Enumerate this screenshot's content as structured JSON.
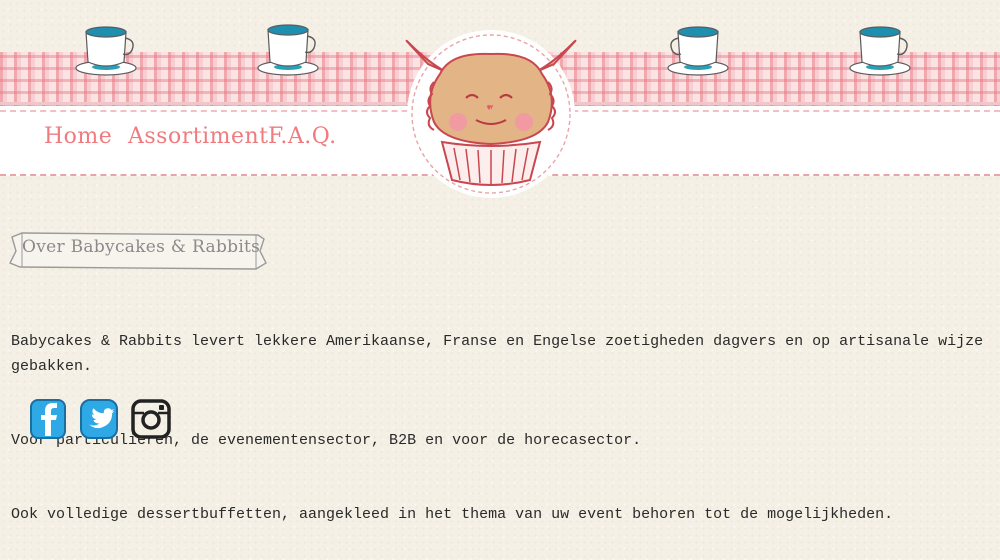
{
  "nav": {
    "items": [
      {
        "label": "Home"
      },
      {
        "label": "Assortiment"
      },
      {
        "label": "F.A.Q."
      }
    ]
  },
  "section": {
    "heading": "Over Babycakes & Rabbits",
    "paragraphs": [
      "Babycakes & Rabbits levert lekkere Amerikaanse, Franse en Engelse zoetigheden dagvers en op artisanale wijze gebakken.",
      "Voor particulieren, de evenementensector, B2B en voor de horecasector.",
      "Ook volledige dessertbuffetten, aangekleed in het thema van uw event behoren tot de mogelijkheden."
    ]
  },
  "social": {
    "icons": [
      "facebook-icon",
      "twitter-icon",
      "instagram-icon"
    ]
  },
  "colors": {
    "accent": "#ef7b7e",
    "background": "#f5f0e6",
    "cloth": "#fbe3e4",
    "social_blue": "#2fa8e6",
    "text": "#2a2a2a"
  }
}
